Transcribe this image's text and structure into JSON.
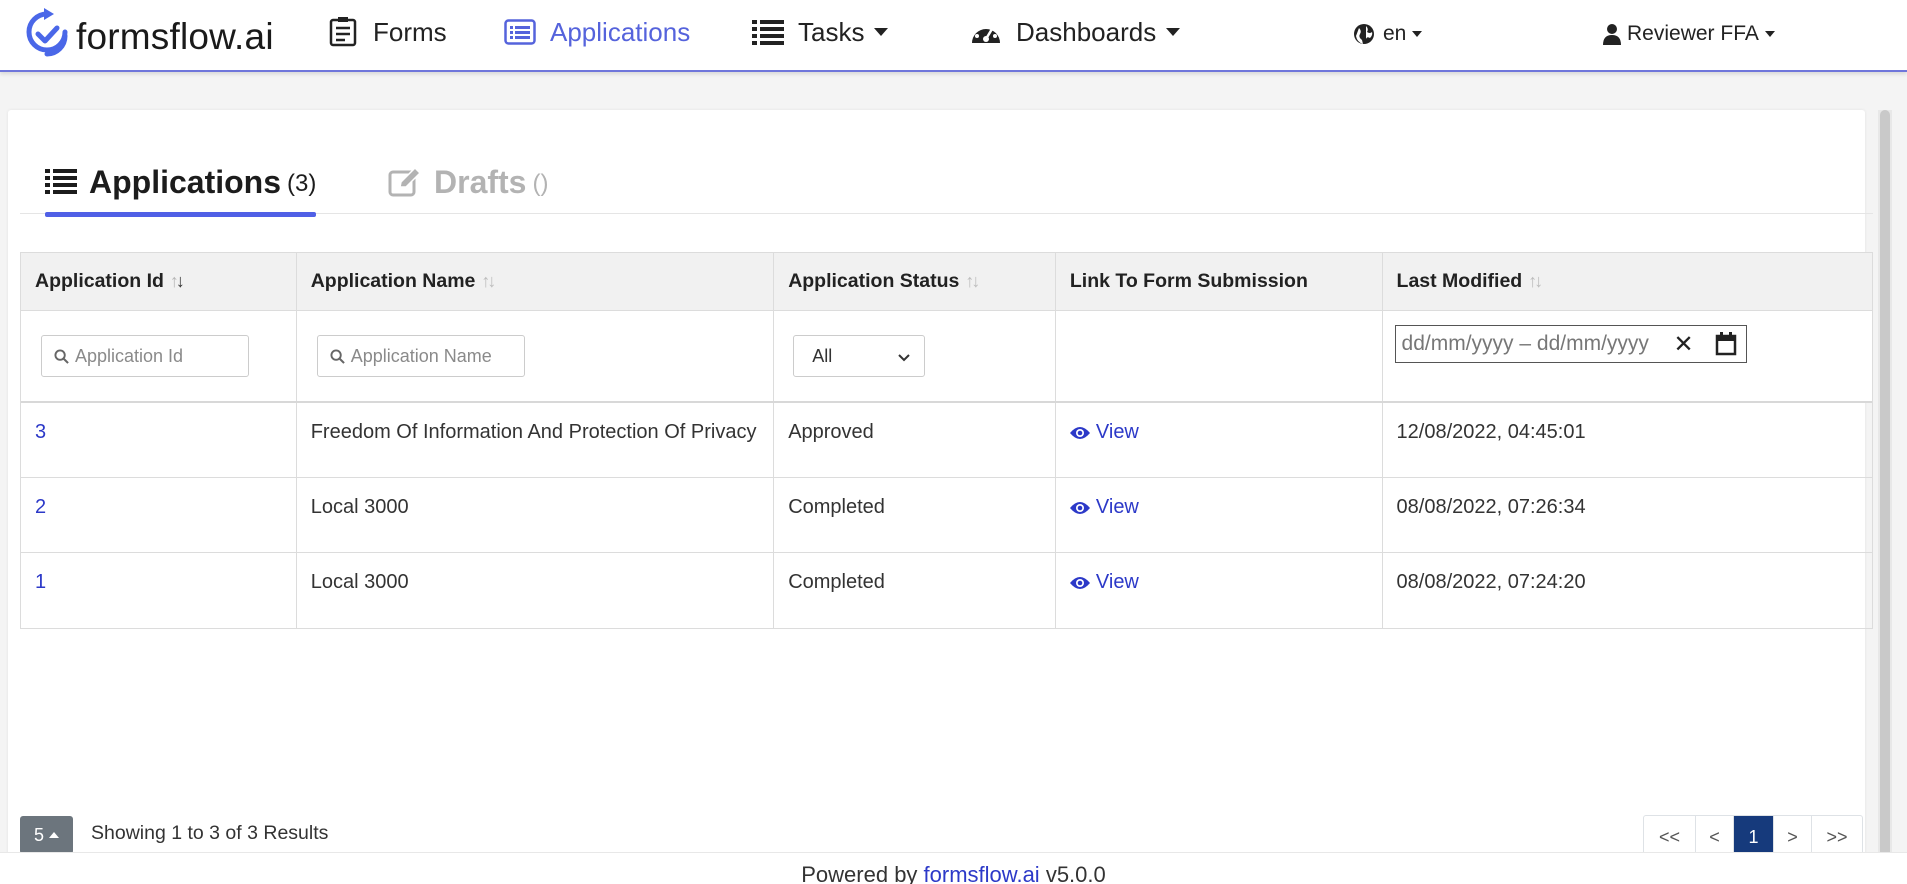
{
  "brand": {
    "name": "formsflow.ai"
  },
  "nav": {
    "forms": "Forms",
    "applications": "Applications",
    "tasks": "Tasks",
    "dashboards": "Dashboards",
    "language": "en",
    "user": "Reviewer FFA"
  },
  "tabs": {
    "applications": {
      "label": "Applications",
      "count": "(3)"
    },
    "drafts": {
      "label": "Drafts",
      "count": "()"
    }
  },
  "table": {
    "headers": {
      "id": "Application Id",
      "name": "Application Name",
      "status": "Application Status",
      "link": "Link To Form Submission",
      "modified": "Last Modified"
    },
    "filters": {
      "id_placeholder": "Application Id",
      "name_placeholder": "Application Name",
      "status_selected": "All",
      "date_placeholder": "dd/mm/yyyy – dd/mm/yyyy",
      "date_clear": "✕"
    },
    "rows": [
      {
        "id": "3",
        "name": "Freedom Of Information And Protection Of Privacy",
        "status": "Approved",
        "link": "View",
        "modified": "12/08/2022, 04:45:01"
      },
      {
        "id": "2",
        "name": "Local 3000",
        "status": "Completed",
        "link": "View",
        "modified": "08/08/2022, 07:26:34"
      },
      {
        "id": "1",
        "name": "Local 3000",
        "status": "Completed",
        "link": "View",
        "modified": "08/08/2022, 07:24:20"
      }
    ]
  },
  "pagination": {
    "page_size": "5",
    "showing": "Showing 1 to 3 of 3 Results",
    "first": "<<",
    "prev": "<",
    "current": "1",
    "next": ">",
    "last": ">>"
  },
  "footer": {
    "prefix": "Powered by ",
    "link": "formsflow.ai",
    "version": " v5.0.0"
  },
  "colors": {
    "accent": "#5563dc",
    "link": "#2c39c8",
    "active_page": "#163a7c",
    "brand_blue": "#4a67e8"
  }
}
